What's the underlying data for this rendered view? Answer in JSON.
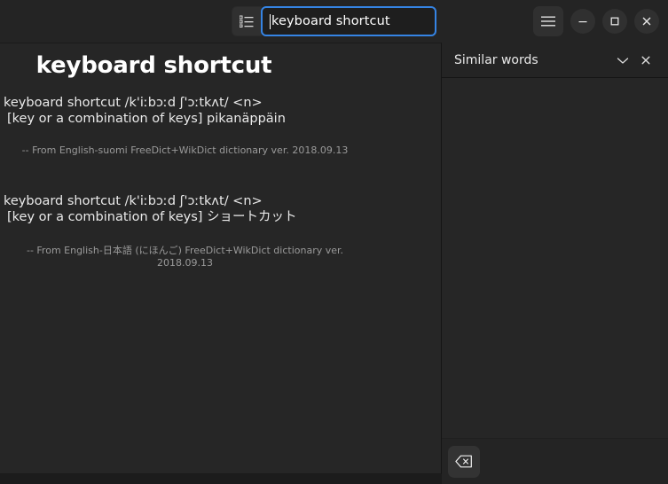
{
  "header": {
    "list_icon": "list-view-icon",
    "search": {
      "value": "keyboard shortcut",
      "placeholder": "Search"
    },
    "menu_icon": "hamburger-menu-icon",
    "window_controls": {
      "minimize": "–",
      "maximize": "□",
      "close": "×"
    },
    "accent_color": "#3584e4"
  },
  "main": {
    "headword": "keyboard shortcut",
    "entries": [
      {
        "headline": "keyboard shortcut /k'iːbɔːd ʃ'ɔːtkʌt/ <n>",
        "definition": "[key or a combination of keys] pikanäppäin",
        "source": "-- From English-suomi FreeDict+WikDict dictionary ver. 2018.09.13"
      },
      {
        "headline": "keyboard shortcut /k'iːbɔːd ʃ'ɔːtkʌt/ <n>",
        "definition": "[key or a combination of keys] ショートカット",
        "source": "-- From English-日本語 (にほんご) FreeDict+WikDict dictionary ver. 2018.09.13"
      }
    ]
  },
  "sidebar": {
    "title": "Similar words",
    "collapse_icon": "chevron-down-icon",
    "close_icon": "close-icon",
    "items": [],
    "footer": {
      "back_icon": "backspace-icon"
    }
  },
  "colors": {
    "window_bg": "#242424",
    "content_bg": "#262626",
    "text": "#e9e9e9",
    "muted_text": "#9a9a9a",
    "accent": "#3584e4"
  }
}
